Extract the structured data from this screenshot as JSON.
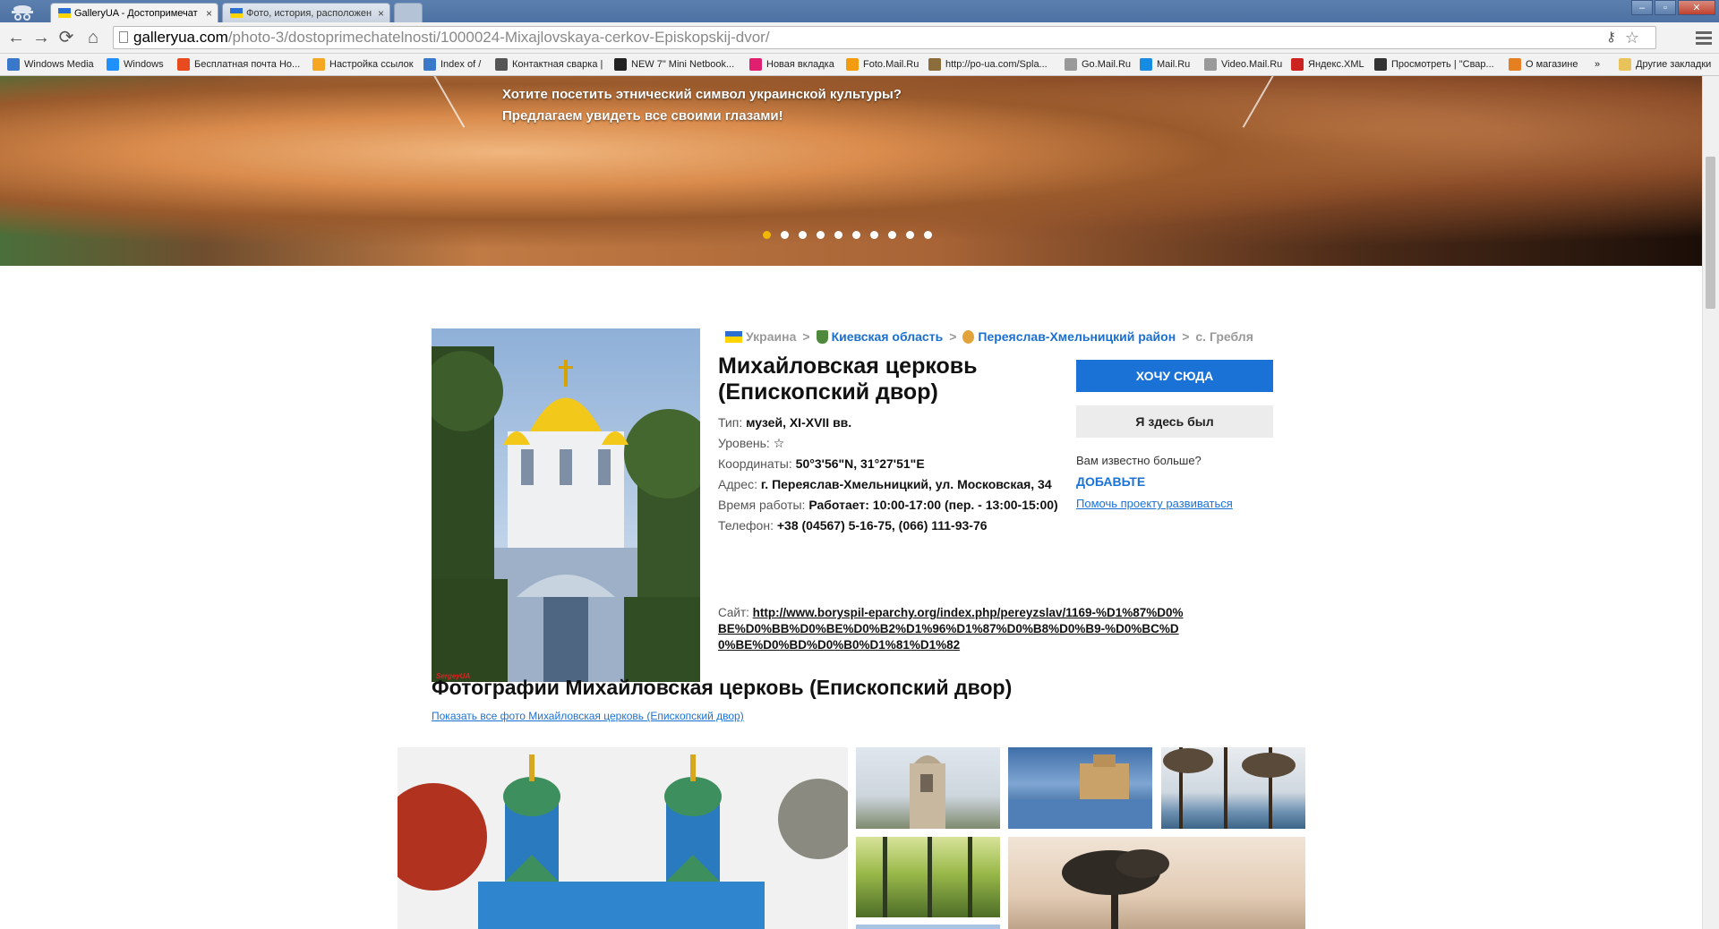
{
  "browser": {
    "tabs": [
      {
        "title": "GalleryUA - Достопримечат",
        "close": "×"
      },
      {
        "title": "Фото, история, расположен",
        "close": "×"
      }
    ],
    "window_controls": {
      "minimize": "–",
      "maximize": "▫",
      "close": "✕"
    },
    "url_domain": "galleryua.com",
    "url_path": "/photo-3/dostoprimechatelnosti/1000024-Mixajlovskaya-cerkov-Episkopskij-dvor/",
    "bookmarks": [
      {
        "label": "Windows Media",
        "color": "#3a78c9"
      },
      {
        "label": "Windows",
        "color": "#1e90ff"
      },
      {
        "label": "Бесплатная почта Ho...",
        "color": "#e84c1e"
      },
      {
        "label": "Настройка ссылок",
        "color": "#f5a623"
      },
      {
        "label": "Index of /",
        "color": "#3a78c9"
      },
      {
        "label": "Контактная сварка |",
        "color": "#555555"
      },
      {
        "label": "NEW 7\" Mini Netbook...",
        "color": "#222222"
      },
      {
        "label": "Новая вкладка",
        "color": "#e0206f"
      },
      {
        "label": "Foto.Mail.Ru",
        "color": "#f39c12"
      },
      {
        "label": "http://po-ua.com/Spla...",
        "color": "#8a6d3b"
      },
      {
        "label": "Go.Mail.Ru",
        "color": "#999999"
      },
      {
        "label": "Mail.Ru",
        "color": "#168de2"
      },
      {
        "label": "Video.Mail.Ru",
        "color": "#999999"
      },
      {
        "label": "Яндекс.XML",
        "color": "#cc2222"
      },
      {
        "label": "Просмотреть | \"Свар...",
        "color": "#333333"
      },
      {
        "label": "О магазине",
        "color": "#e67e22"
      }
    ],
    "bookmarks_more": "»",
    "other_bookmarks": "Другие закладки"
  },
  "hero": {
    "line1": "Хотите посетить этнический символ украинской культуры?",
    "line2": "Предлагаем увидеть все своими глазами!",
    "slides_total": 10,
    "active_slide": 1
  },
  "breadcrumb": {
    "country": "Украина",
    "region": "Киевская область",
    "district": "Переяслав-Хмельницкий район",
    "village": "с. Гребля",
    "sep": ">"
  },
  "place": {
    "title": "Михайловская церковь (Епископский двор)",
    "type_label": "Тип:",
    "type_value": "музей, XI-XVII вв.",
    "level_label": "Уровень:",
    "level_value": "☆",
    "coords_label": "Координаты:",
    "coords_value": "50°3'56\"N, 31°27'51\"E",
    "address_label": "Адрес:",
    "address_value": "г. Переяслав-Хмельницкий, ул. Московская, 34",
    "hours_label": "Время работы:",
    "hours_value": "Работает: 10:00-17:00 (пер. - 13:00-15:00)",
    "phone_label": "Телефон:",
    "phone_value": "+38 (04567) 5-16-75, (066) 111-93-76",
    "site_label": "Сайт:",
    "site_value": "http://www.boryspil-eparchy.org/index.php/pereyzslav/1169-%D1%87%D0%BE%D0%BB%D0%BE%D0%B2%D1%96%D1%87%D0%B8%D0%B9-%D0%BC%D0%BE%D0%BD%D0%B0%D1%81%D1%82",
    "photo_watermark": "SergeyUA"
  },
  "actions": {
    "want_label": "ХОЧУ СЮДА",
    "been_label": "Я здесь был",
    "know_more": "Вам известно больше?",
    "add_label": "ДОБАВЬТЕ",
    "help_label": "Помочь проекту развиваться"
  },
  "photos": {
    "title": "Фотографии Михайловская церковь (Епископский двор)",
    "show_all": "Показать все фото Михайловская церковь (Епископский двор)"
  }
}
